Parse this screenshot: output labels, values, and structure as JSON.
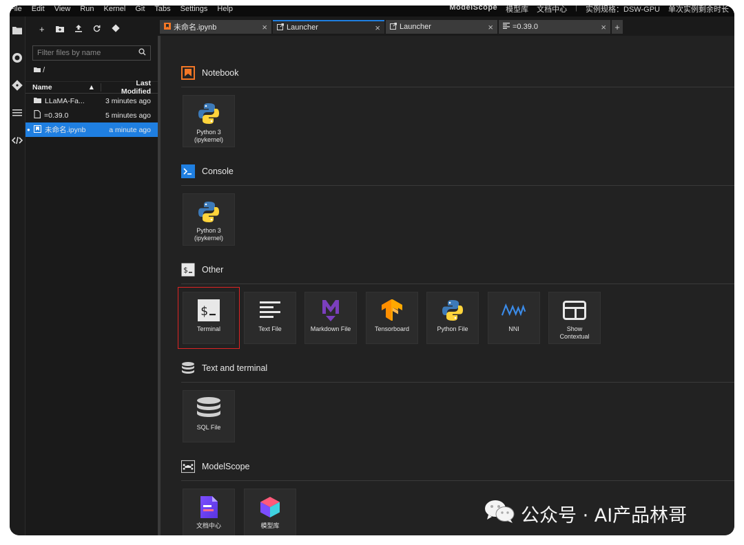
{
  "menubar": {
    "items": [
      "File",
      "Edit",
      "View",
      "Run",
      "Kernel",
      "Git",
      "Tabs",
      "Settings",
      "Help"
    ],
    "brand": "ModelScope",
    "links": [
      "模型库",
      "文档中心"
    ],
    "instance": "实例规格：DSW-GPU",
    "remaining": "单次实例剩余时长"
  },
  "filebrowser": {
    "search_placeholder": "Filter files by name",
    "breadcrumb": "/",
    "col_name": "Name",
    "col_modified": "Last Modified",
    "files": [
      {
        "name": "LLaMA-Fa...",
        "modified": "3 minutes ago",
        "type": "folder"
      },
      {
        "name": "=0.39.0",
        "modified": "5 minutes ago",
        "type": "file"
      },
      {
        "name": "未命名.ipynb",
        "modified": "a minute ago",
        "type": "notebook"
      }
    ]
  },
  "tabs": [
    {
      "label": "未命名.ipynb",
      "icon": "notebook-icon"
    },
    {
      "label": "Launcher",
      "icon": "launcher-icon"
    },
    {
      "label": "Launcher",
      "icon": "launcher-icon"
    },
    {
      "label": "=0.39.0",
      "icon": "text-file-icon"
    }
  ],
  "launcher": {
    "sections": {
      "notebook": "Notebook",
      "console": "Console",
      "other": "Other",
      "text_terminal": "Text and terminal",
      "modelscope": "ModelScope"
    },
    "notebook_cards": [
      {
        "l1": "Python 3",
        "l2": "(ipykernel)"
      }
    ],
    "console_cards": [
      {
        "l1": "Python 3",
        "l2": "(ipykernel)"
      }
    ],
    "other_cards": [
      {
        "l1": "Terminal",
        "l2": ""
      },
      {
        "l1": "Text File",
        "l2": ""
      },
      {
        "l1": "Markdown File",
        "l2": ""
      },
      {
        "l1": "Tensorboard",
        "l2": ""
      },
      {
        "l1": "Python File",
        "l2": ""
      },
      {
        "l1": "NNI",
        "l2": ""
      },
      {
        "l1": "Show",
        "l2": "Contextual"
      }
    ],
    "text_terminal_cards": [
      {
        "l1": "SQL File",
        "l2": ""
      }
    ],
    "modelscope_cards": [
      {
        "l1": "文档中心",
        "l2": ""
      },
      {
        "l1": "模型库",
        "l2": ""
      }
    ]
  },
  "watermark": "公众号 · AI产品林哥",
  "colors": {
    "accent": "#1f7fe1",
    "highlight": "#e02424",
    "notebook_orange": "#f37726"
  }
}
